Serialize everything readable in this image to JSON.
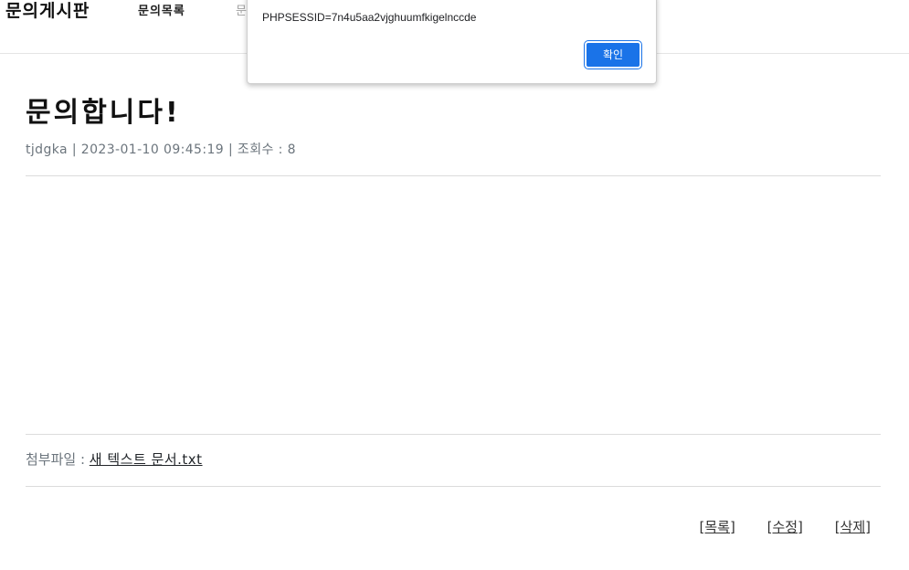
{
  "navbar": {
    "brand": "문의게시판",
    "links": [
      {
        "label": "문의목록"
      },
      {
        "label": "문"
      }
    ]
  },
  "post": {
    "title": "문의합니다!",
    "meta": "tjdgka | 2023-01-10 09:45:19 | 조회수 : 8",
    "body": "",
    "attachment_label": "첨부파일 : ",
    "attachment_file": "새 텍스트 문서.txt"
  },
  "actions": {
    "list": "[목록]",
    "edit": "[수정]",
    "delete": "[삭제]"
  },
  "dialog": {
    "message": "PHPSESSID=7n4u5aa2vjghuumfkigelnccde",
    "ok_label": "확인",
    "accent_color": "#1a73e8"
  }
}
